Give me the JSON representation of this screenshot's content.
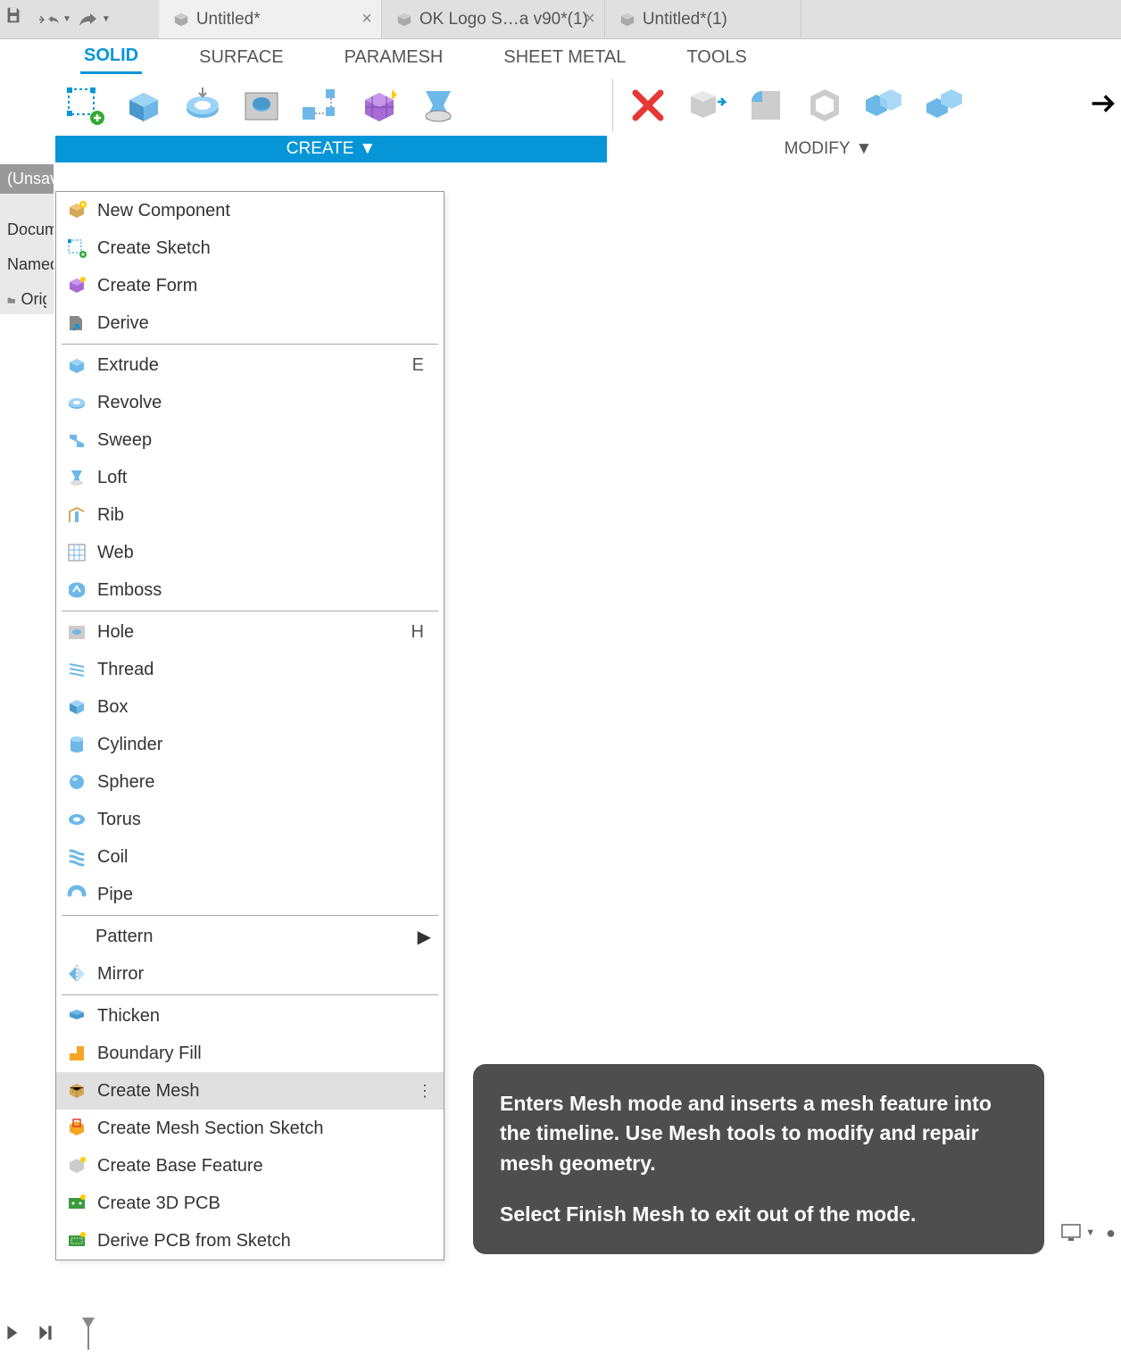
{
  "titlebar": {
    "tabs": [
      {
        "label": "Untitled*",
        "closable": true
      },
      {
        "label": "OK Logo S…a v90*(1)",
        "closable": true
      },
      {
        "label": "Untitled*(1)",
        "closable": false
      }
    ]
  },
  "ribbon": {
    "tabs": [
      "SOLID",
      "SURFACE",
      "PARAMESH",
      "SHEET METAL",
      "TOOLS"
    ],
    "activeTab": "SOLID",
    "groups": {
      "create": "CREATE",
      "modify": "MODIFY"
    }
  },
  "leftPanel": {
    "header": "(Unsaved)",
    "rows": [
      "Document",
      "Named",
      "Origin"
    ]
  },
  "createMenu": {
    "items": [
      {
        "label": "New Component",
        "icon": "component"
      },
      {
        "label": "Create Sketch",
        "icon": "sketch"
      },
      {
        "label": "Create Form",
        "icon": "form"
      },
      {
        "label": "Derive",
        "icon": "derive"
      },
      {
        "sep": true
      },
      {
        "label": "Extrude",
        "icon": "extrude",
        "shortcut": "E"
      },
      {
        "label": "Revolve",
        "icon": "revolve"
      },
      {
        "label": "Sweep",
        "icon": "sweep"
      },
      {
        "label": "Loft",
        "icon": "loft"
      },
      {
        "label": "Rib",
        "icon": "rib"
      },
      {
        "label": "Web",
        "icon": "web"
      },
      {
        "label": "Emboss",
        "icon": "emboss"
      },
      {
        "sep": true
      },
      {
        "label": "Hole",
        "icon": "hole",
        "shortcut": "H"
      },
      {
        "label": "Thread",
        "icon": "thread"
      },
      {
        "label": "Box",
        "icon": "box"
      },
      {
        "label": "Cylinder",
        "icon": "cylinder"
      },
      {
        "label": "Sphere",
        "icon": "sphere"
      },
      {
        "label": "Torus",
        "icon": "torus"
      },
      {
        "label": "Coil",
        "icon": "coil"
      },
      {
        "label": "Pipe",
        "icon": "pipe"
      },
      {
        "sep": true
      },
      {
        "label": "Pattern",
        "submenu": true,
        "indent": true
      },
      {
        "label": "Mirror",
        "icon": "mirror"
      },
      {
        "sep": true
      },
      {
        "label": "Thicken",
        "icon": "thicken"
      },
      {
        "label": "Boundary Fill",
        "icon": "boundary"
      },
      {
        "label": "Create Mesh",
        "icon": "mesh",
        "hover": true,
        "more": true
      },
      {
        "label": "Create Mesh Section Sketch",
        "icon": "meshsec"
      },
      {
        "label": "Create Base Feature",
        "icon": "basefeat"
      },
      {
        "label": "Create 3D PCB",
        "icon": "pcb"
      },
      {
        "label": "Derive PCB from Sketch",
        "icon": "pcbsk"
      }
    ]
  },
  "tooltip": {
    "line1": "Enters Mesh mode and inserts a mesh feature into the timeline. Use Mesh tools to modify and repair mesh geometry.",
    "line2": "Select Finish Mesh to exit out of the mode."
  }
}
